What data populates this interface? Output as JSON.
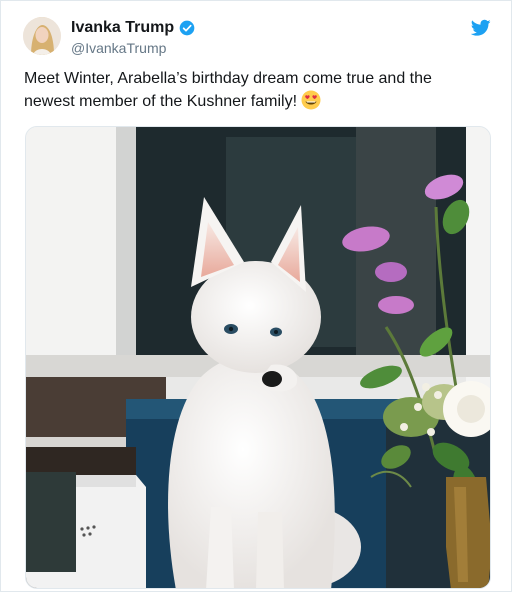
{
  "author": {
    "display_name": "Ivanka Trump",
    "handle": "@IvankaTrump",
    "verified": true
  },
  "tweet": {
    "text": "Meet Winter, Arabella’s birthday dream come true and the newest member of the Kushner family!",
    "emoji": "smiling-face-with-heart-eyes"
  },
  "icons": {
    "brand": "twitter-bird-icon",
    "verified_badge": "verified-badge-icon"
  },
  "colors": {
    "twitter_blue": "#1da1f2",
    "name_text": "#14171a",
    "handle_text": "#657786"
  }
}
